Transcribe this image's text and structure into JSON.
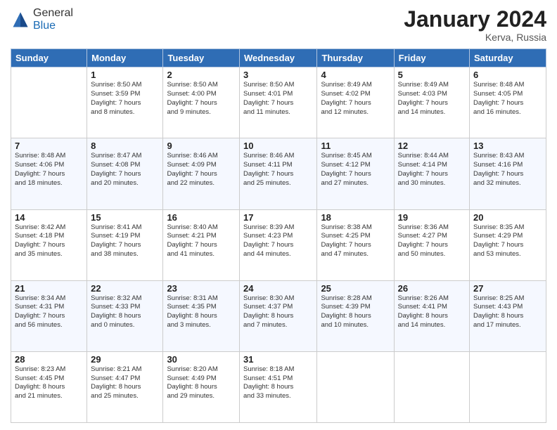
{
  "logo": {
    "general": "General",
    "blue": "Blue"
  },
  "title": "January 2024",
  "location": "Kerva, Russia",
  "days_header": [
    "Sunday",
    "Monday",
    "Tuesday",
    "Wednesday",
    "Thursday",
    "Friday",
    "Saturday"
  ],
  "weeks": [
    [
      {
        "day": "",
        "info": ""
      },
      {
        "day": "1",
        "info": "Sunrise: 8:50 AM\nSunset: 3:59 PM\nDaylight: 7 hours\nand 8 minutes."
      },
      {
        "day": "2",
        "info": "Sunrise: 8:50 AM\nSunset: 4:00 PM\nDaylight: 7 hours\nand 9 minutes."
      },
      {
        "day": "3",
        "info": "Sunrise: 8:50 AM\nSunset: 4:01 PM\nDaylight: 7 hours\nand 11 minutes."
      },
      {
        "day": "4",
        "info": "Sunrise: 8:49 AM\nSunset: 4:02 PM\nDaylight: 7 hours\nand 12 minutes."
      },
      {
        "day": "5",
        "info": "Sunrise: 8:49 AM\nSunset: 4:03 PM\nDaylight: 7 hours\nand 14 minutes."
      },
      {
        "day": "6",
        "info": "Sunrise: 8:48 AM\nSunset: 4:05 PM\nDaylight: 7 hours\nand 16 minutes."
      }
    ],
    [
      {
        "day": "7",
        "info": "Sunrise: 8:48 AM\nSunset: 4:06 PM\nDaylight: 7 hours\nand 18 minutes."
      },
      {
        "day": "8",
        "info": "Sunrise: 8:47 AM\nSunset: 4:08 PM\nDaylight: 7 hours\nand 20 minutes."
      },
      {
        "day": "9",
        "info": "Sunrise: 8:46 AM\nSunset: 4:09 PM\nDaylight: 7 hours\nand 22 minutes."
      },
      {
        "day": "10",
        "info": "Sunrise: 8:46 AM\nSunset: 4:11 PM\nDaylight: 7 hours\nand 25 minutes."
      },
      {
        "day": "11",
        "info": "Sunrise: 8:45 AM\nSunset: 4:12 PM\nDaylight: 7 hours\nand 27 minutes."
      },
      {
        "day": "12",
        "info": "Sunrise: 8:44 AM\nSunset: 4:14 PM\nDaylight: 7 hours\nand 30 minutes."
      },
      {
        "day": "13",
        "info": "Sunrise: 8:43 AM\nSunset: 4:16 PM\nDaylight: 7 hours\nand 32 minutes."
      }
    ],
    [
      {
        "day": "14",
        "info": "Sunrise: 8:42 AM\nSunset: 4:18 PM\nDaylight: 7 hours\nand 35 minutes."
      },
      {
        "day": "15",
        "info": "Sunrise: 8:41 AM\nSunset: 4:19 PM\nDaylight: 7 hours\nand 38 minutes."
      },
      {
        "day": "16",
        "info": "Sunrise: 8:40 AM\nSunset: 4:21 PM\nDaylight: 7 hours\nand 41 minutes."
      },
      {
        "day": "17",
        "info": "Sunrise: 8:39 AM\nSunset: 4:23 PM\nDaylight: 7 hours\nand 44 minutes."
      },
      {
        "day": "18",
        "info": "Sunrise: 8:38 AM\nSunset: 4:25 PM\nDaylight: 7 hours\nand 47 minutes."
      },
      {
        "day": "19",
        "info": "Sunrise: 8:36 AM\nSunset: 4:27 PM\nDaylight: 7 hours\nand 50 minutes."
      },
      {
        "day": "20",
        "info": "Sunrise: 8:35 AM\nSunset: 4:29 PM\nDaylight: 7 hours\nand 53 minutes."
      }
    ],
    [
      {
        "day": "21",
        "info": "Sunrise: 8:34 AM\nSunset: 4:31 PM\nDaylight: 7 hours\nand 56 minutes."
      },
      {
        "day": "22",
        "info": "Sunrise: 8:32 AM\nSunset: 4:33 PM\nDaylight: 8 hours\nand 0 minutes."
      },
      {
        "day": "23",
        "info": "Sunrise: 8:31 AM\nSunset: 4:35 PM\nDaylight: 8 hours\nand 3 minutes."
      },
      {
        "day": "24",
        "info": "Sunrise: 8:30 AM\nSunset: 4:37 PM\nDaylight: 8 hours\nand 7 minutes."
      },
      {
        "day": "25",
        "info": "Sunrise: 8:28 AM\nSunset: 4:39 PM\nDaylight: 8 hours\nand 10 minutes."
      },
      {
        "day": "26",
        "info": "Sunrise: 8:26 AM\nSunset: 4:41 PM\nDaylight: 8 hours\nand 14 minutes."
      },
      {
        "day": "27",
        "info": "Sunrise: 8:25 AM\nSunset: 4:43 PM\nDaylight: 8 hours\nand 17 minutes."
      }
    ],
    [
      {
        "day": "28",
        "info": "Sunrise: 8:23 AM\nSunset: 4:45 PM\nDaylight: 8 hours\nand 21 minutes."
      },
      {
        "day": "29",
        "info": "Sunrise: 8:21 AM\nSunset: 4:47 PM\nDaylight: 8 hours\nand 25 minutes."
      },
      {
        "day": "30",
        "info": "Sunrise: 8:20 AM\nSunset: 4:49 PM\nDaylight: 8 hours\nand 29 minutes."
      },
      {
        "day": "31",
        "info": "Sunrise: 8:18 AM\nSunset: 4:51 PM\nDaylight: 8 hours\nand 33 minutes."
      },
      {
        "day": "",
        "info": ""
      },
      {
        "day": "",
        "info": ""
      },
      {
        "day": "",
        "info": ""
      }
    ]
  ]
}
